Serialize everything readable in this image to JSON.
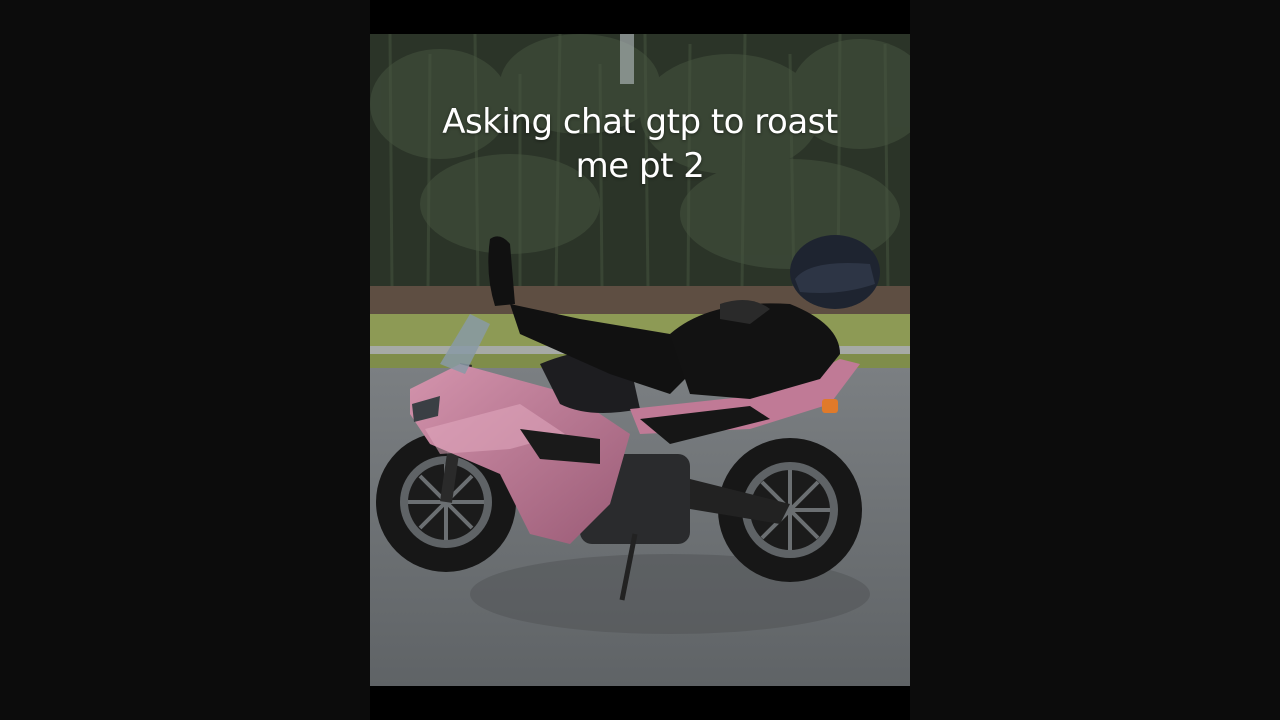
{
  "video": {
    "caption_line1": "Asking chat gtp to roast",
    "caption_line2": "me pt 2",
    "scene": "person lying back on a pink sport motorcycle in a parking lot in front of pine trees",
    "colors": {
      "page_background": "#0c0c0c",
      "letterbox": "#000000",
      "motorcycle_paint": "#c07a96",
      "asphalt": "#6e7275",
      "trees": "#2f3a2c",
      "grass": "#8d9a55",
      "caption_text": "#ffffff"
    }
  }
}
